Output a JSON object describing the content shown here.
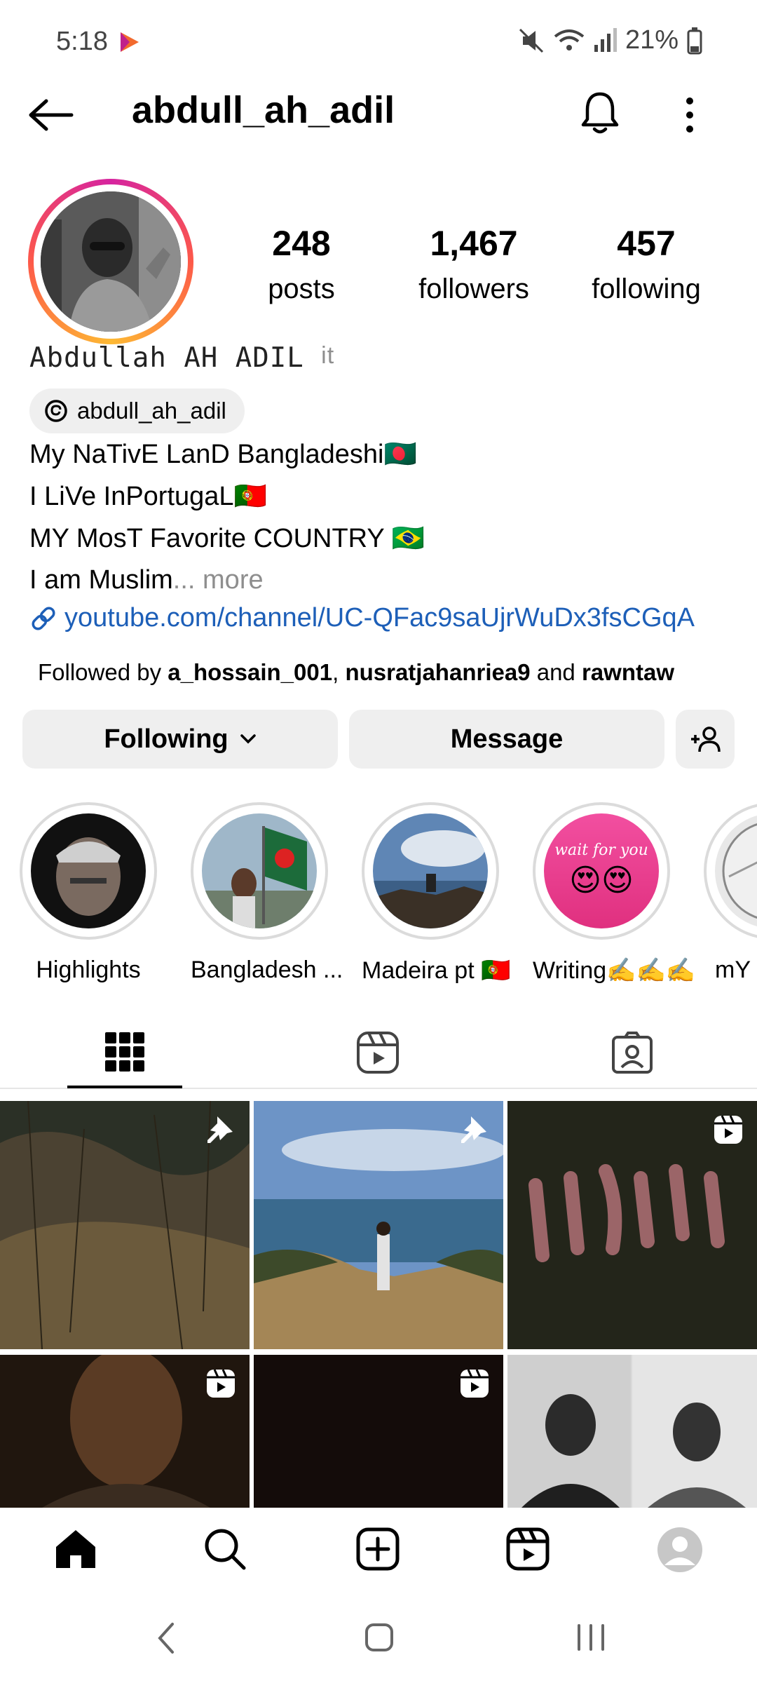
{
  "status_bar": {
    "time": "5:18",
    "battery": "21%"
  },
  "header": {
    "username": "abdull_ah_adil",
    "back_icon": "arrow-left-icon",
    "bell_icon": "bell-icon",
    "more_icon": "more-vertical-icon"
  },
  "stats": {
    "posts_count": "248",
    "posts_label": "posts",
    "followers_count": "1,467",
    "followers_label": "followers",
    "following_count": "457",
    "following_label": "following"
  },
  "bio": {
    "display_name": "Abdullah AH ADIL",
    "pronoun_tag": "it",
    "threads_handle": "abdull_ah_adil",
    "line1": "My NaTivE LanD  Bangladeshi🇧🇩",
    "line2": "I LiVe InPortugaL🇵🇹",
    "line3": "MY MosT Favorite COUNTRY 🇧🇷",
    "line4": "I am Muslim",
    "more": "... more",
    "link": "youtube.com/channel/UC-QFac9saUjrWuDx3fsCGqA",
    "followed_by_prefix": "Followed by ",
    "followed_by_1": "a_hossain_001",
    "followed_by_sep": ", ",
    "followed_by_2": "nusratjahanriea9",
    "followed_by_and": " and ",
    "followed_by_3": "rawntaw"
  },
  "actions": {
    "following_label": "Following",
    "message_label": "Message"
  },
  "highlights": [
    {
      "label": "Highlights"
    },
    {
      "label": "Bangladesh ..."
    },
    {
      "label": "Madeira pt 🇵🇹"
    },
    {
      "label": "Writing✍️✍️✍️"
    },
    {
      "label": "mY"
    }
  ],
  "highlight_text": {
    "wait_for_you": "wait for you",
    "emoji": "😍😍"
  },
  "tabs": [
    {
      "name": "grid-icon",
      "active": true
    },
    {
      "name": "reels-icon",
      "active": false
    },
    {
      "name": "tagged-icon",
      "active": false
    }
  ],
  "posts": [
    {
      "badge": "pin-icon"
    },
    {
      "badge": "pin-icon"
    },
    {
      "badge": "reel-icon"
    },
    {
      "badge": "reel-icon"
    },
    {
      "badge": "reel-icon"
    },
    {
      "badge": ""
    }
  ],
  "bottom_nav": [
    "home-icon",
    "search-icon",
    "create-icon",
    "reels-icon",
    "profile-icon"
  ],
  "colors": {
    "link": "#1d5fb8",
    "button_bg": "#efefef",
    "ring_pink": "#d6249f",
    "ring_orange": "#fdb933"
  }
}
